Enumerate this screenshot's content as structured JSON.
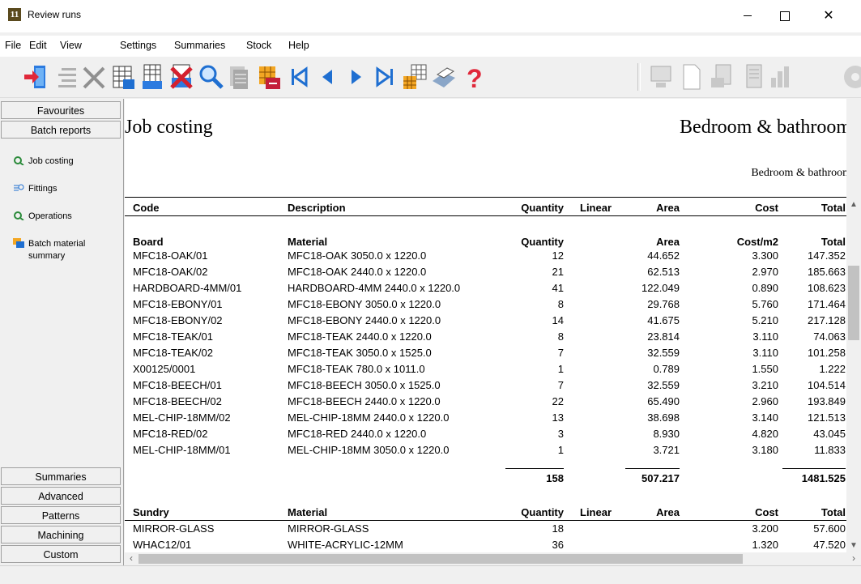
{
  "window": {
    "title": "Review runs",
    "app_icon_text": "11"
  },
  "menu": [
    "File",
    "Edit",
    "View",
    "Settings",
    "Summaries",
    "Stock",
    "Help"
  ],
  "toolbar": {
    "icons": [
      "exit-icon",
      "list-icon",
      "delete-icon",
      "grid-icon",
      "batch-grid-icon",
      "cancel-batch-icon",
      "search-icon",
      "print-preview-icon",
      "export-icon",
      "first-page-icon",
      "previous-page-icon",
      "next-page-icon",
      "last-page-icon",
      "stack-icon",
      "printer-icon",
      "help-icon",
      "monitor-disabled-icon",
      "page-disabled-icon",
      "report-disabled-icon",
      "document-disabled-icon",
      "chart-disabled-icon",
      "gear-disabled-icon"
    ],
    "accent": "#1f6fd1"
  },
  "sidebar": {
    "top_tabs": [
      "Favourites",
      "Batch reports"
    ],
    "items": [
      {
        "label": "Job costing",
        "icon": "job-costing-icon"
      },
      {
        "label": "Fittings",
        "icon": "fittings-icon"
      },
      {
        "label": "Operations",
        "icon": "operations-icon"
      },
      {
        "label": "Batch material summary",
        "icon": "batch-material-icon"
      }
    ],
    "bottom_tabs": [
      "Summaries",
      "Advanced",
      "Patterns",
      "Machining",
      "Custom"
    ]
  },
  "report": {
    "title": "Job costing",
    "section": "Bedroom & bathroom",
    "subtitle": "Bedroom & bathroom",
    "headers": {
      "code": "Code",
      "description": "Description",
      "quantity": "Quantity",
      "linear": "Linear",
      "area": "Area",
      "cost": "Cost",
      "total": "Total"
    },
    "board": {
      "headers": {
        "code": "Board",
        "material": "Material",
        "quantity": "Quantity",
        "area": "Area",
        "cost": "Cost/m2",
        "total": "Total"
      },
      "rows": [
        [
          "MFC18-OAK/01",
          "MFC18-OAK 3050.0 x 1220.0",
          "12",
          "44.652",
          "3.300",
          "147.352"
        ],
        [
          "MFC18-OAK/02",
          "MFC18-OAK 2440.0 x 1220.0",
          "21",
          "62.513",
          "2.970",
          "185.663"
        ],
        [
          "HARDBOARD-4MM/01",
          "HARDBOARD-4MM 2440.0 x 1220.0",
          "41",
          "122.049",
          "0.890",
          "108.623"
        ],
        [
          "MFC18-EBONY/01",
          "MFC18-EBONY 3050.0 x 1220.0",
          "8",
          "29.768",
          "5.760",
          "171.464"
        ],
        [
          "MFC18-EBONY/02",
          "MFC18-EBONY 2440.0 x 1220.0",
          "14",
          "41.675",
          "5.210",
          "217.128"
        ],
        [
          "MFC18-TEAK/01",
          "MFC18-TEAK 2440.0 x 1220.0",
          "8",
          "23.814",
          "3.110",
          "74.063"
        ],
        [
          "MFC18-TEAK/02",
          "MFC18-TEAK 3050.0 x 1525.0",
          "7",
          "32.559",
          "3.110",
          "101.258"
        ],
        [
          "X00125/0001",
          "MFC18-TEAK 780.0 x 1011.0",
          "1",
          "0.789",
          "1.550",
          "1.222"
        ],
        [
          "MFC18-BEECH/01",
          "MFC18-BEECH 3050.0 x 1525.0",
          "7",
          "32.559",
          "3.210",
          "104.514"
        ],
        [
          "MFC18-BEECH/02",
          "MFC18-BEECH 2440.0 x 1220.0",
          "22",
          "65.490",
          "2.960",
          "193.849"
        ],
        [
          "MEL-CHIP-18MM/02",
          "MEL-CHIP-18MM 2440.0 x 1220.0",
          "13",
          "38.698",
          "3.140",
          "121.513"
        ],
        [
          "MFC18-RED/02",
          "MFC18-RED 2440.0 x 1220.0",
          "3",
          "8.930",
          "4.820",
          "43.045"
        ],
        [
          "MEL-CHIP-18MM/01",
          "MEL-CHIP-18MM 3050.0 x 1220.0",
          "1",
          "3.721",
          "3.180",
          "11.833"
        ]
      ],
      "totals": {
        "quantity": "158",
        "area": "507.217",
        "total": "1481.525"
      }
    },
    "sundry": {
      "headers": {
        "code": "Sundry",
        "material": "Material",
        "quantity": "Quantity",
        "linear": "Linear",
        "area": "Area",
        "cost": "Cost",
        "total": "Total"
      },
      "rows": [
        [
          "MIRROR-GLASS",
          "MIRROR-GLASS",
          "18",
          "3.200",
          "57.600"
        ],
        [
          "WHAC12/01",
          "WHITE-ACRYLIC-12MM",
          "36",
          "1.320",
          "47.520"
        ]
      ]
    }
  }
}
